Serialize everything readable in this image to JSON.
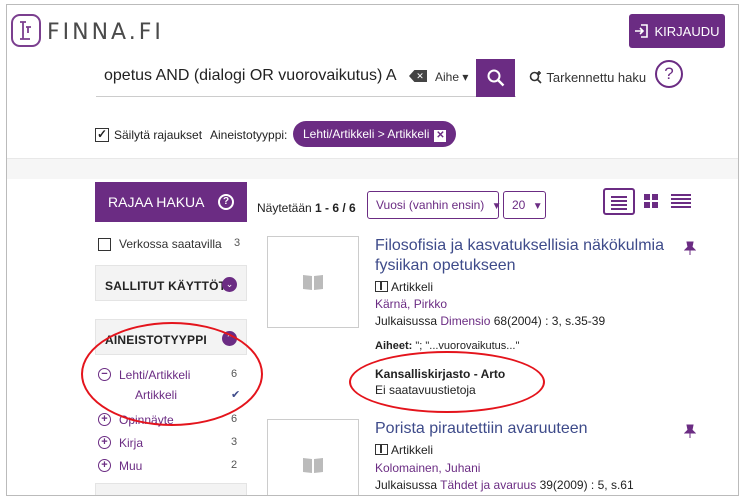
{
  "header": {
    "logo_text": "FINNA.FI",
    "login_label": "KIRJAUDU"
  },
  "search": {
    "query": "opetus AND (dialogi OR vuorovaikutus) A",
    "field": "Aihe",
    "advanced_label": "Tarkennettu haku",
    "help": "?"
  },
  "filters": {
    "keep_label": "Säilytä rajaukset",
    "keep_checked": true,
    "type_label": "Aineistotyyppi:",
    "active_chip": "Lehti/Artikkeli > Artikkeli"
  },
  "sidebar": {
    "refine_label": "RAJAA HAKUA",
    "online_label": "Verkossa saatavilla",
    "online_count": "3",
    "facet_usage": "SALLITUT KÄYTTÖTAVAT",
    "facet_type": "AINEISTOTYYPPI",
    "items": [
      {
        "label": "Lehti/Artikkeli",
        "count": "6",
        "sign": "−"
      },
      {
        "label": "Artikkeli",
        "count": "✔",
        "sign": ""
      },
      {
        "label": "Opinnäyte",
        "count": "6",
        "sign": "+"
      },
      {
        "label": "Kirja",
        "count": "3",
        "sign": "+"
      },
      {
        "label": "Muu",
        "count": "2",
        "sign": "+"
      }
    ]
  },
  "results": {
    "showing_prefix": "Näytetään",
    "showing_range": "1 - 6 / 6",
    "sort_label": "Vuosi (vanhin ensin)",
    "limit_label": "20",
    "records": [
      {
        "title": "Filosofisia ja kasvatuksellisia näkökulmia fysiikan opetukseen",
        "format": "Artikkeli",
        "author": "Kärnä, Pirkko",
        "pub_prefix": "Julkaisussa",
        "pub_link": "Dimensio",
        "pub_rest": "68(2004) : 3, s.35-39",
        "subjects_label": "Aiheet:",
        "subjects": "\";  \"...vuorovaikutus...\"",
        "library": "Kansalliskirjasto - Arto",
        "availability": "Ei saatavuustietoja"
      },
      {
        "title": "Porista pirautettiin avaruuteen",
        "format": "Artikkeli",
        "author": "Kolomainen, Juhani",
        "pub_prefix": "Julkaisussa",
        "pub_link": "Tähdet ja avaruus",
        "pub_rest": "39(2009) : 5, s.61"
      }
    ]
  },
  "colors": {
    "accent": "#6b2c83",
    "title_link": "#3e4b8a",
    "annotation": "#e4141c"
  }
}
